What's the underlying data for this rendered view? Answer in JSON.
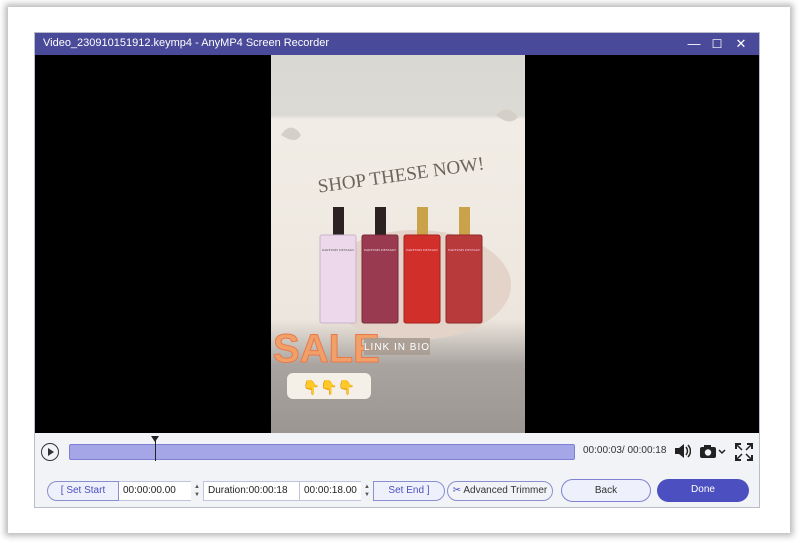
{
  "window": {
    "title": "Video_230910151912.keymp4  -  AnyMP4 Screen Recorder",
    "minimize_glyph": "—",
    "maximize_glyph": "☐",
    "close_glyph": "✕"
  },
  "video": {
    "headline": "SHOP THESE NOW!",
    "sale_text": "SALE",
    "link_text": "LINK IN BIO",
    "emoji_row": "👇👇👇",
    "bottle_labels": [
      "PARFUMS DESSIAN",
      "PARFUMS DESSIAN",
      "PARFUMS DESSIAN",
      "PARFUMS DESSIAN"
    ]
  },
  "player": {
    "time_display": "00:00:03/ 00:00:18",
    "progress": 0.17
  },
  "trim": {
    "set_start_label": "[ Set Start",
    "start_value": "00:00:00.00",
    "duration_label": "Duration:00:00:18",
    "end_value": "00:00:18.00",
    "set_end_label": "Set End ]",
    "advanced_trimmer_label": "Advanced Trimmer",
    "back_label": "Back",
    "done_label": "Done"
  },
  "colors": {
    "titlebar": "#4a4a9a",
    "accent": "#4c4fc0",
    "track": "#a5a6e8"
  },
  "icons": [
    "play-icon",
    "volume-icon",
    "camera-icon",
    "fullscreen-icon",
    "advanced-trimmer-icon",
    "close-icon",
    "minimize-icon",
    "maximize-icon"
  ]
}
